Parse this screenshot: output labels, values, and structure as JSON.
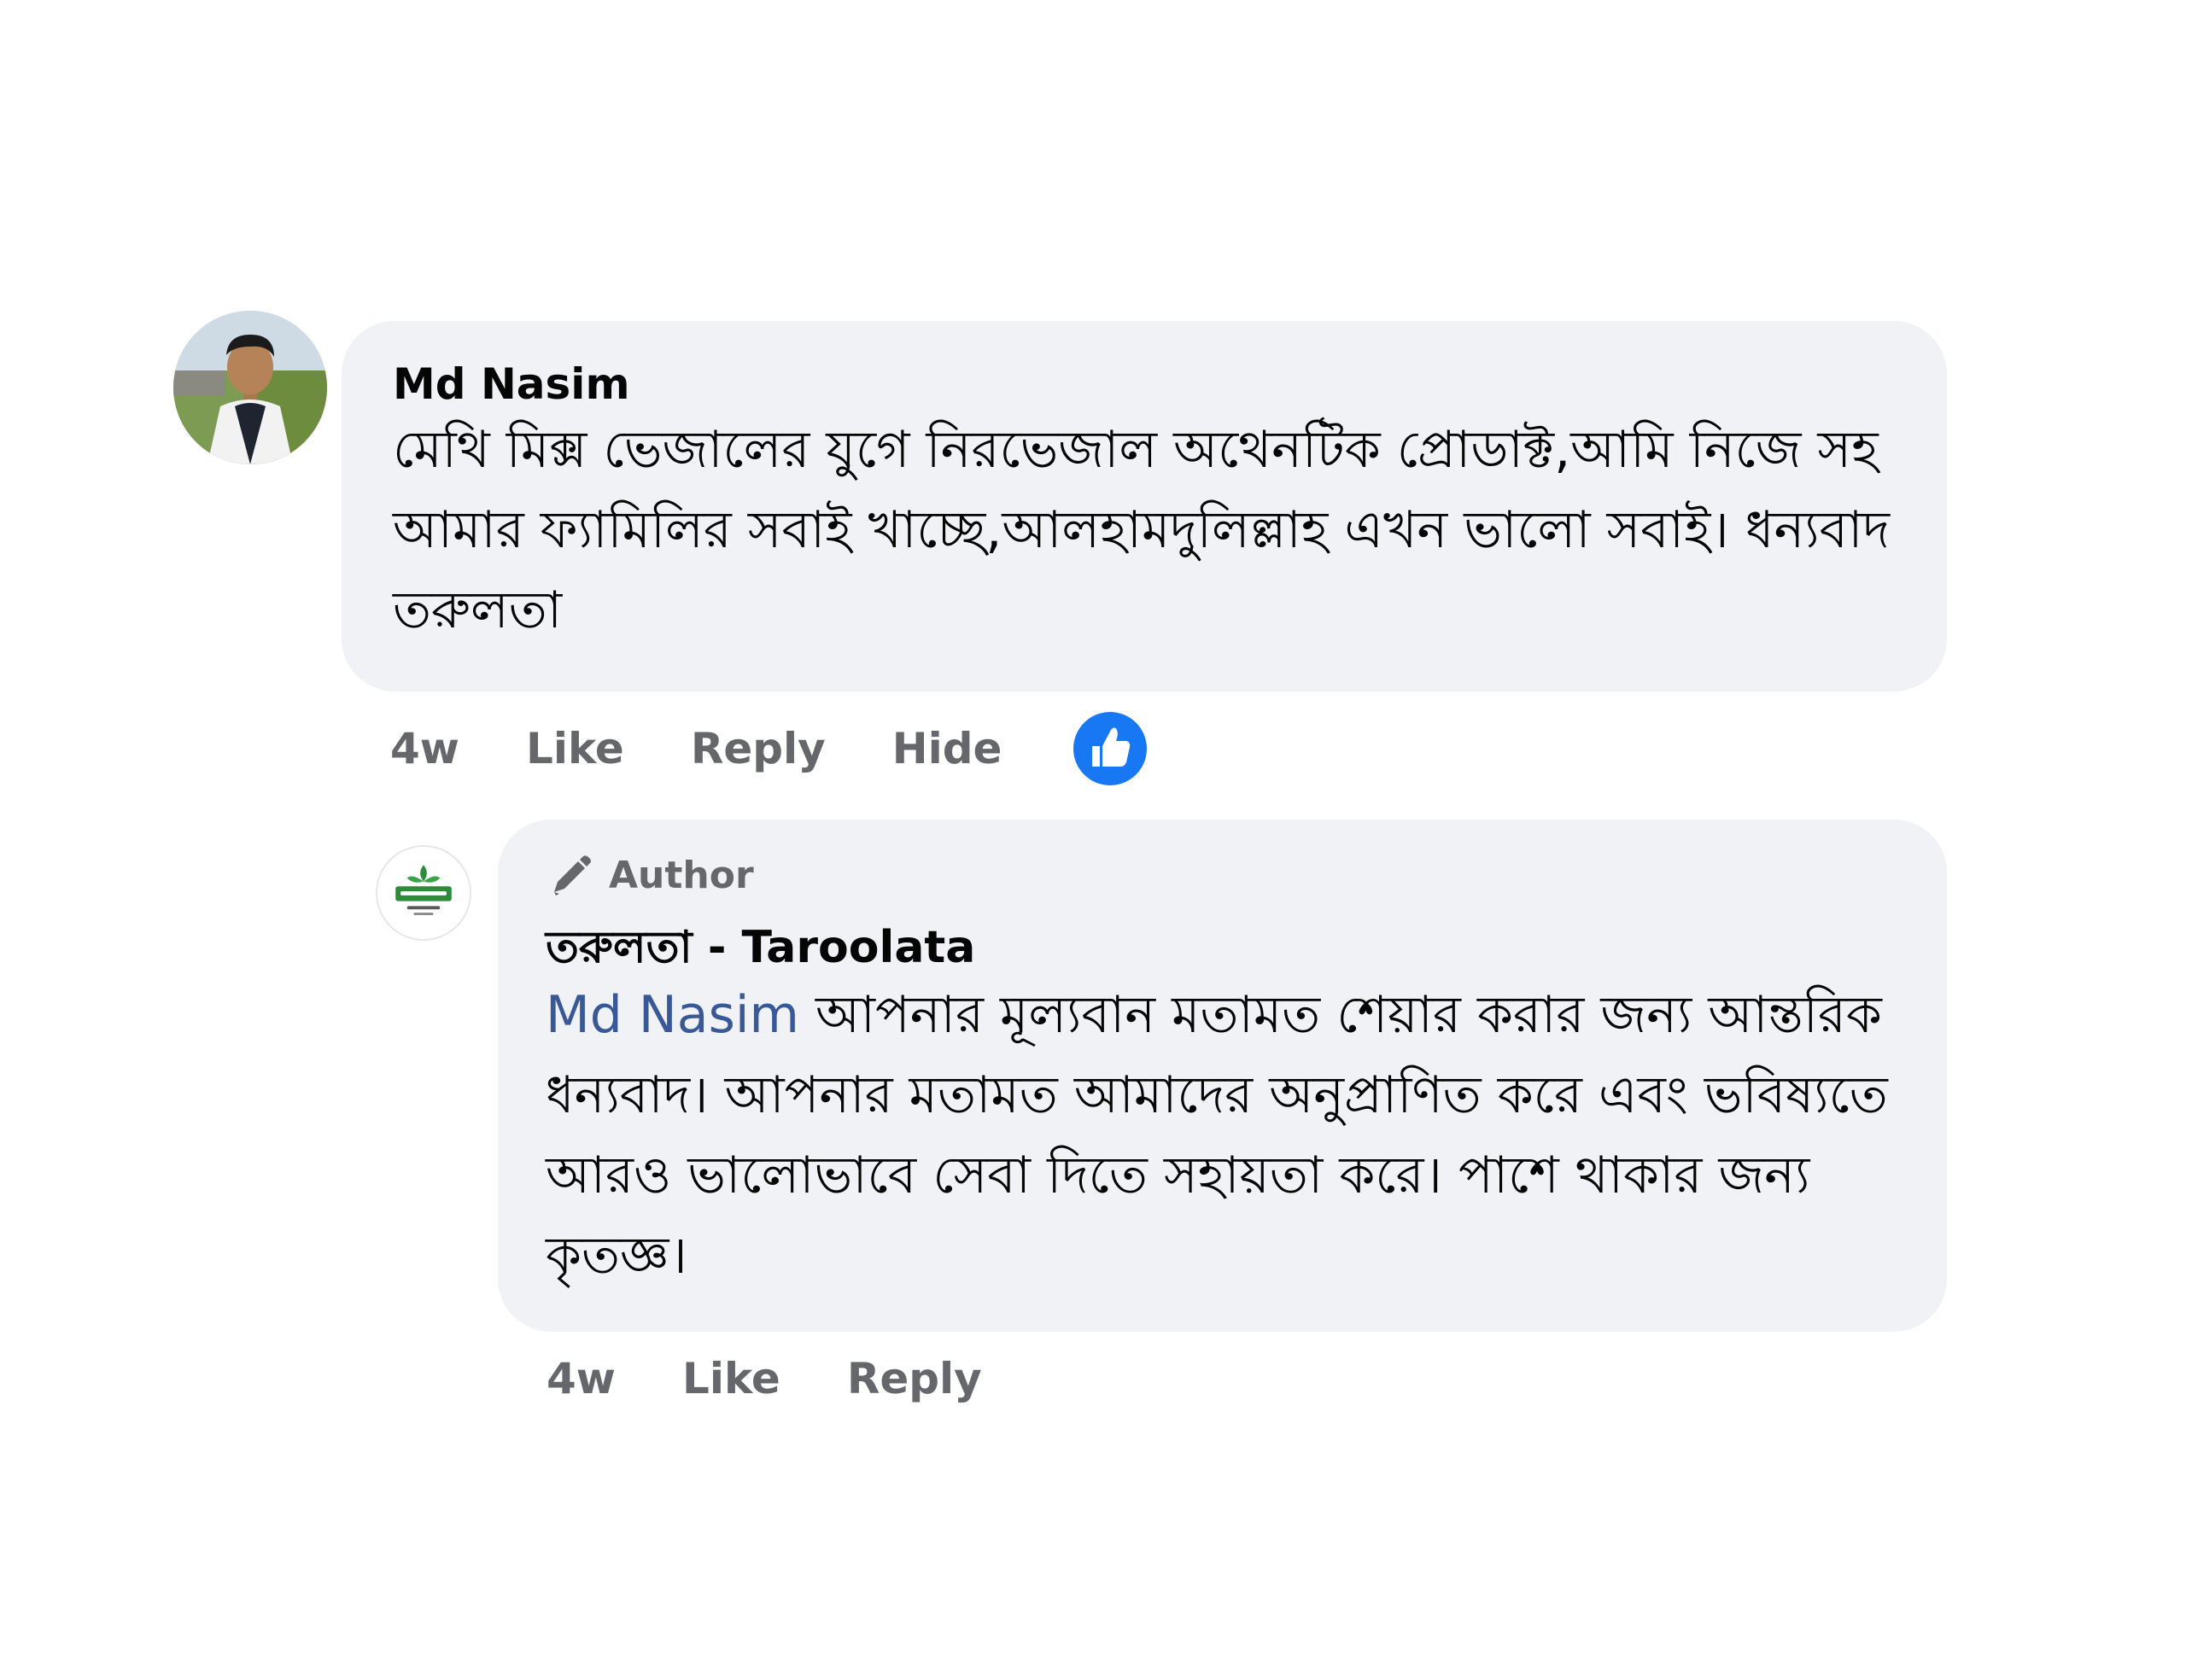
{
  "comment": {
    "author": "Md Nasim",
    "text": "মেথি মিক্স ভেজালের যুগে নিরভেজাল অথেনটিক প্রোডাক্ট,আমি নিজে সহ আমার ফ্যামিলির সবাই খাচ্ছে,আলহামদুলিল্লাহ এখন ভালো সবাই। ধন্যবাদ তরুলতা",
    "time": "4w",
    "like_label": "Like",
    "reply_label": "Reply",
    "hide_label": "Hide",
    "reaction_icon": "thumbs-up-icon"
  },
  "reply": {
    "badge": "Author",
    "author": "তরুলতা - Taroolata",
    "mention": "Md Nasim",
    "text": "আপনার মূল্যবান মতামত শেয়ার করার জন্য আন্তরিক ধন্যবাদ। আপনার মতামত আমাদের অনুপ্রাণিত করে এবং ভবিষ্যতে আরও ভালোভাবে সেবা দিতে সহায়তা করে। পাশে থাকার জন্য কৃতজ্ঞ।",
    "time": "4w",
    "like_label": "Like",
    "reply_label": "Reply"
  },
  "colors": {
    "bubble": "#f0f2f5",
    "mention": "#385898",
    "like_blue": "#1877f2",
    "meta_text": "#65676b"
  }
}
